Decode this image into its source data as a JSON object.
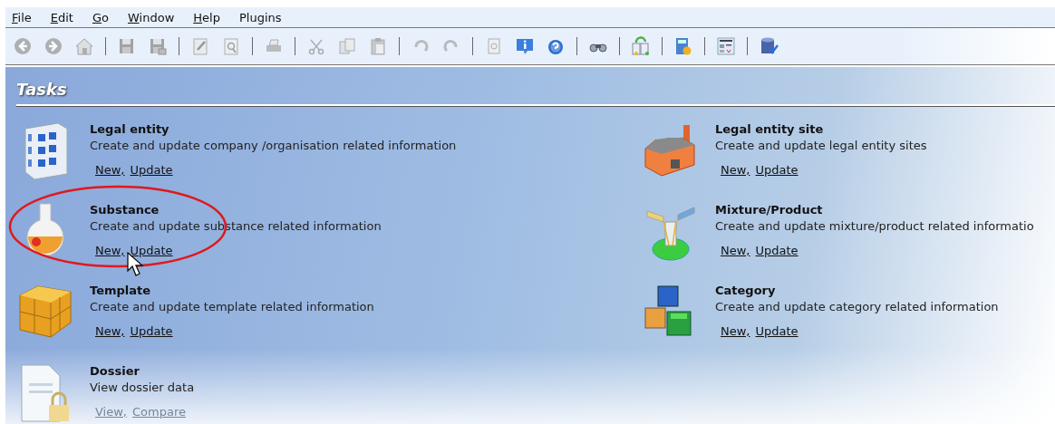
{
  "menu": [
    {
      "label": "File",
      "underlined_initial": true
    },
    {
      "label": "Edit",
      "underlined_initial": true
    },
    {
      "label": "Go",
      "underlined_initial": true
    },
    {
      "label": "Window",
      "underlined_initial": true
    },
    {
      "label": "Help",
      "underlined_initial": true
    },
    {
      "label": "Plugins",
      "underlined_initial": false
    }
  ],
  "toolbar": [
    {
      "kind": "back",
      "disabled": true
    },
    {
      "kind": "forward",
      "disabled": true
    },
    {
      "kind": "home",
      "disabled": true
    },
    {
      "kind": "separator"
    },
    {
      "kind": "save",
      "disabled": true
    },
    {
      "kind": "save-all",
      "disabled": true
    },
    {
      "kind": "separator"
    },
    {
      "kind": "edit",
      "disabled": true
    },
    {
      "kind": "preview",
      "disabled": true
    },
    {
      "kind": "separator"
    },
    {
      "kind": "print",
      "disabled": true
    },
    {
      "kind": "separator"
    },
    {
      "kind": "cut",
      "disabled": true
    },
    {
      "kind": "copy",
      "disabled": true
    },
    {
      "kind": "paste",
      "disabled": true
    },
    {
      "kind": "separator"
    },
    {
      "kind": "undo",
      "disabled": true
    },
    {
      "kind": "redo",
      "disabled": true
    },
    {
      "kind": "separator"
    },
    {
      "kind": "document",
      "disabled": true
    },
    {
      "kind": "info",
      "disabled": false
    },
    {
      "kind": "help",
      "disabled": false
    },
    {
      "kind": "separator"
    },
    {
      "kind": "binoculars",
      "disabled": false
    },
    {
      "kind": "separator"
    },
    {
      "kind": "import",
      "disabled": false
    },
    {
      "kind": "separator"
    },
    {
      "kind": "calculator",
      "disabled": false
    },
    {
      "kind": "separator"
    },
    {
      "kind": "form",
      "disabled": false
    },
    {
      "kind": "separator"
    },
    {
      "kind": "database",
      "disabled": false
    }
  ],
  "section_title": "Tasks",
  "tasks": [
    {
      "kind": "building",
      "title": "Legal entity",
      "description": "Create and update company /organisation related information",
      "highlighted": false,
      "links": [
        {
          "label": "New,",
          "disabled": false
        },
        {
          "label": "Update",
          "disabled": false
        }
      ]
    },
    {
      "kind": "factory",
      "title": "Legal entity site",
      "description": "Create and update legal entity sites",
      "highlighted": false,
      "links": [
        {
          "label": "New,",
          "disabled": false
        },
        {
          "label": "Update",
          "disabled": false
        }
      ]
    },
    {
      "kind": "flask",
      "title": "Substance",
      "description": "Create and update substance related information",
      "highlighted": true,
      "links": [
        {
          "label": "New,",
          "disabled": false
        },
        {
          "label": "Update",
          "disabled": false
        }
      ]
    },
    {
      "kind": "mixture",
      "title": "Mixture/Product",
      "description": "Create and update mixture/product related informatio",
      "highlighted": false,
      "links": [
        {
          "label": "New,",
          "disabled": false
        },
        {
          "label": "Update",
          "disabled": false
        }
      ]
    },
    {
      "kind": "box",
      "title": "Template",
      "description": "Create and update template related information",
      "highlighted": false,
      "links": [
        {
          "label": "New,",
          "disabled": false
        },
        {
          "label": "Update",
          "disabled": false
        }
      ]
    },
    {
      "kind": "blocks",
      "title": "Category",
      "description": "Create and update category related information",
      "highlighted": false,
      "links": [
        {
          "label": "New,",
          "disabled": false
        },
        {
          "label": "Update",
          "disabled": false
        }
      ]
    },
    {
      "kind": "dossier",
      "title": "Dossier",
      "description": "View dossier data",
      "highlighted": false,
      "links": [
        {
          "label": "View,",
          "disabled": true
        },
        {
          "label": "Compare",
          "disabled": true
        }
      ]
    }
  ]
}
